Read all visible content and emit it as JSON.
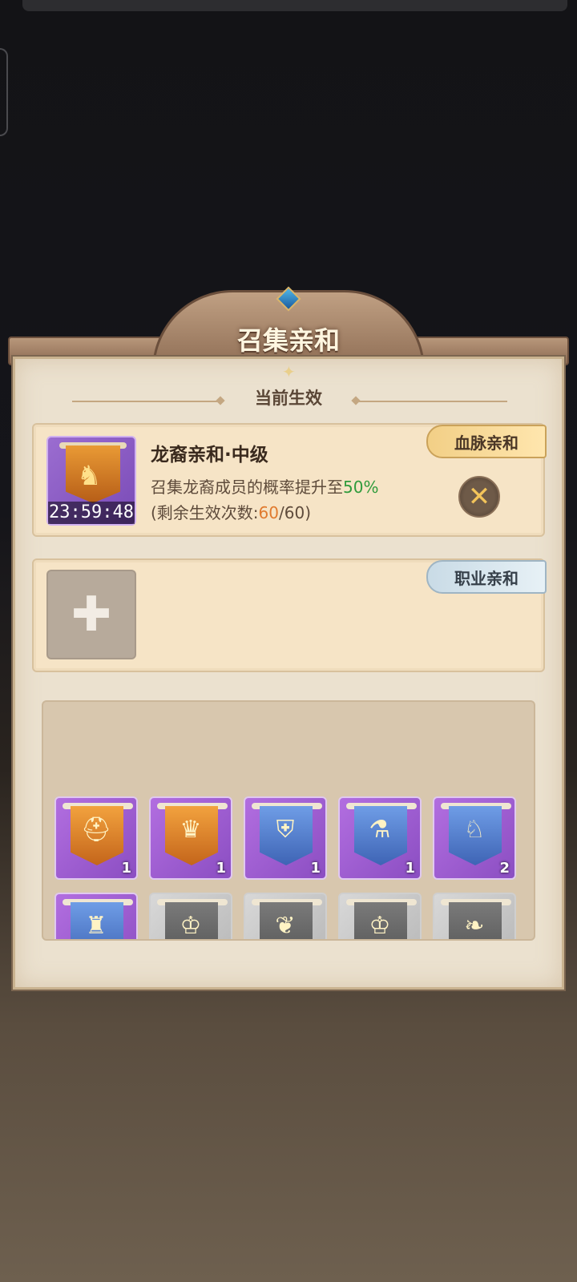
{
  "panel": {
    "title": "召集亲和",
    "section_label": "当前生效"
  },
  "bloodline": {
    "tag": "血脉亲和",
    "buff_name": "龙裔亲和·中级",
    "desc_prefix": "召集龙裔成员的概率提升至",
    "desc_value": "50%",
    "count_prefix": "(剩余生效次数:",
    "count_remaining": "60",
    "count_suffix": "/60)",
    "timer": "23:59:48",
    "emblem_icon": "dragon-emblem-icon",
    "close_icon": "cross-swords-icon"
  },
  "career": {
    "tag": "职业亲和",
    "add_icon": "plus-icon"
  },
  "inventory": {
    "row1": [
      {
        "emblem": "helmet-icon",
        "count": "1"
      },
      {
        "emblem": "lion-icon",
        "count": "1"
      },
      {
        "emblem": "shield-icon",
        "count": "1"
      },
      {
        "emblem": "potion-icon",
        "count": "1"
      },
      {
        "emblem": "wolf-icon",
        "count": "2"
      }
    ],
    "row2": [
      {
        "emblem": "blue-banner-icon"
      },
      {
        "emblem": "crown-icon"
      },
      {
        "emblem": "laurel-icon"
      },
      {
        "emblem": "crown-icon"
      },
      {
        "emblem": "leaf-icon"
      }
    ]
  },
  "colors": {
    "accent_green": "#2f9b3c",
    "accent_orange": "#e07a2e",
    "tag_gold": "#f2cf86",
    "tag_blue": "#c9dbe6",
    "rarity_purple": "#9b6dd0"
  }
}
